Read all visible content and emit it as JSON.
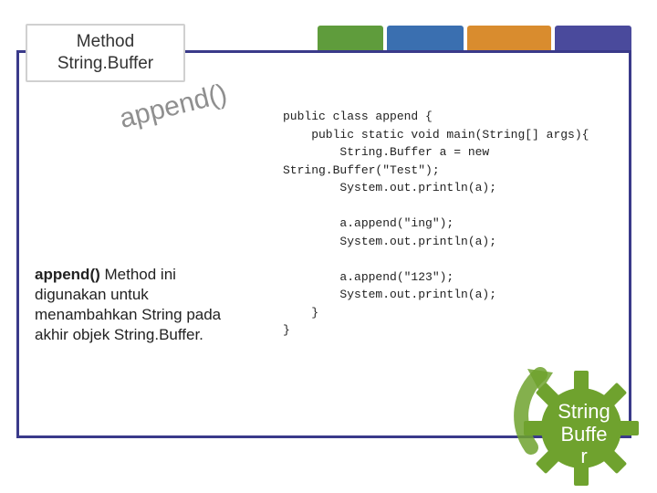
{
  "colors": {
    "frame": "#3a3a8a",
    "gear": "#6fa22e",
    "tabs": [
      "#5f9c3c",
      "#3a6fb0",
      "#d98c2e",
      "#4a4a9c"
    ]
  },
  "tab_widths": [
    72,
    84,
    92,
    84
  ],
  "header": {
    "line1": "Method",
    "line2": "String.Buffer"
  },
  "rotated_label": "append()",
  "description": {
    "bold": "append()",
    "rest": "  Method ini digunakan untuk menambahkan String pada akhir objek String.Buffer."
  },
  "code": "public class append {\n    public static void main(String[] args){\n        String.Buffer a = new\nString.Buffer(\"Test\");\n        System.out.println(a);\n\n        a.append(\"ing\");\n        System.out.println(a);\n\n        a.append(\"123\");\n        System.out.println(a);\n    }\n}",
  "gear": {
    "line1": "String",
    "line2": "Buffe",
    "line3": "r"
  }
}
